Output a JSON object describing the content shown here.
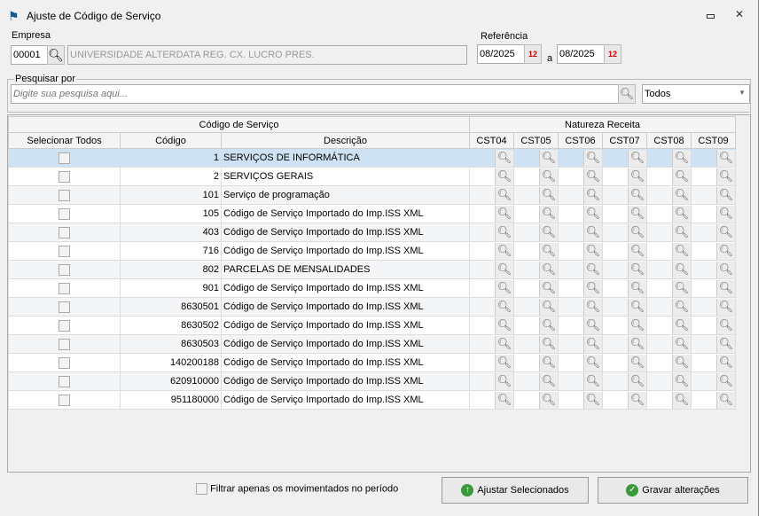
{
  "window": {
    "title": "Ajuste de Código de Serviço"
  },
  "empresa": {
    "label": "Empresa",
    "code": "00001",
    "name": "UNIVERSIDADE ALTERDATA REG. CX. LUCRO PRES."
  },
  "referencia": {
    "label": "Referência",
    "from": "08/2025",
    "sep": "a",
    "to": "08/2025"
  },
  "search": {
    "group_label": "Pesquisar por",
    "placeholder": "Digite sua pesquisa aqui...",
    "filter": "Todos"
  },
  "table": {
    "group_headers": [
      "Código de Serviço",
      "Natureza Receita"
    ],
    "columns": [
      "Selecionar Todos",
      "Código",
      "Descrição",
      "CST04",
      "CST05",
      "CST06",
      "CST07",
      "CST08",
      "CST09"
    ],
    "rows": [
      {
        "code": "1",
        "desc": "SERVIÇOS DE INFORMÁTICA"
      },
      {
        "code": "2",
        "desc": "SERVIÇOS GERAIS"
      },
      {
        "code": "101",
        "desc": "Serviço de programação"
      },
      {
        "code": "105",
        "desc": "Código de Serviço Importado do Imp.ISS XML"
      },
      {
        "code": "403",
        "desc": "Código de Serviço Importado do Imp.ISS XML"
      },
      {
        "code": "716",
        "desc": "Código de Serviço Importado do Imp.ISS XML"
      },
      {
        "code": "802",
        "desc": "PARCELAS DE MENSALIDADES"
      },
      {
        "code": "901",
        "desc": "Código de Serviço Importado do Imp.ISS XML"
      },
      {
        "code": "8630501",
        "desc": "Código de Serviço Importado do Imp.ISS XML"
      },
      {
        "code": "8630502",
        "desc": "Código de Serviço Importado do Imp.ISS XML"
      },
      {
        "code": "8630503",
        "desc": "Código de Serviço Importado do Imp.ISS XML"
      },
      {
        "code": "140200188",
        "desc": "Código de Serviço Importado do Imp.ISS XML"
      },
      {
        "code": "620910000",
        "desc": "Código de Serviço Importado do Imp.ISS XML"
      },
      {
        "code": "951180000",
        "desc": "Código de Serviço Importado do Imp.ISS XML"
      }
    ]
  },
  "footer": {
    "filter_label": "Filtrar apenas os movimentados no período",
    "adjust": "Ajustar Selecionados",
    "save": "Gravar alterações"
  }
}
